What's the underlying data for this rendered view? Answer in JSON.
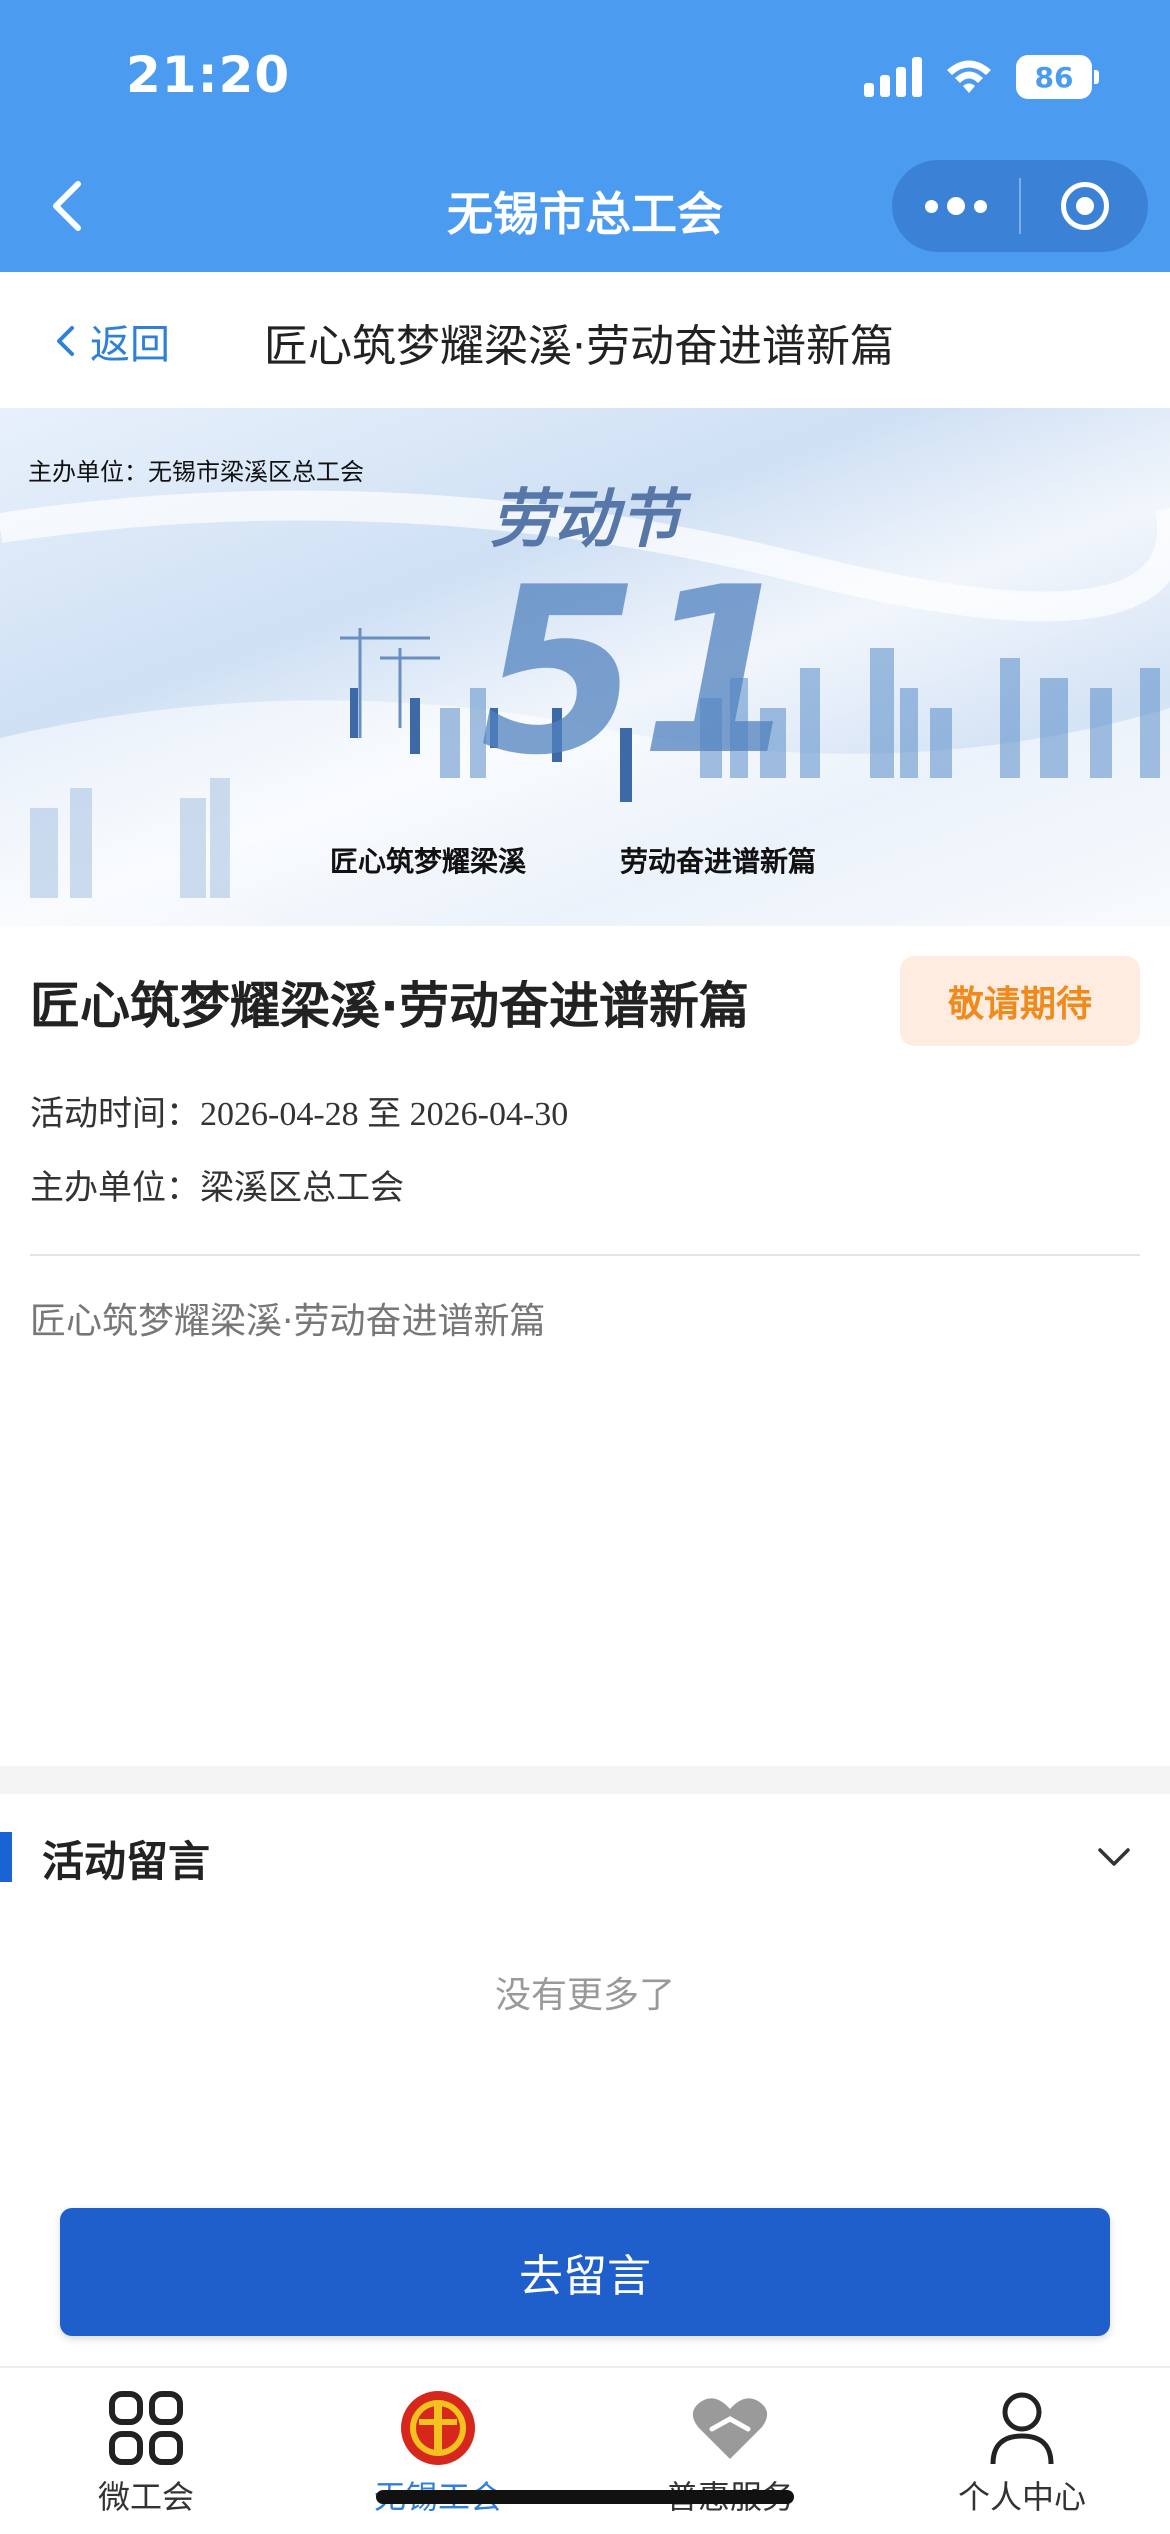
{
  "status_bar": {
    "time": "21:20",
    "battery": "86"
  },
  "nav": {
    "title": "无锡市总工会"
  },
  "subheader": {
    "back_label": "返回",
    "title": "匠心筑梦耀梁溪·劳动奋进谱新篇"
  },
  "banner": {
    "organizer": "主办单位：无锡市梁溪区总工会",
    "festival_text": "劳动节",
    "number": "51",
    "slogan_left": "匠心筑梦耀梁溪",
    "slogan_right": "劳动奋进谱新篇"
  },
  "activity": {
    "title": "匠心筑梦耀梁溪·劳动奋进谱新篇",
    "status": "敬请期待",
    "time_label": "活动时间：",
    "time_value": "2026-04-28 至 2026-04-30",
    "organizer_label": "主办单位：",
    "organizer_value": "梁溪区总工会",
    "description": "匠心筑梦耀梁溪·劳动奋进谱新篇"
  },
  "comments": {
    "title": "活动留言",
    "empty_text": "没有更多了",
    "button_label": "去留言"
  },
  "tabbar": {
    "items": [
      {
        "label": "微工会",
        "icon": "grid-icon"
      },
      {
        "label": "无锡工会",
        "icon": "union-emblem-icon"
      },
      {
        "label": "普惠服务",
        "icon": "heart-hands-icon"
      },
      {
        "label": "个人中心",
        "icon": "person-icon"
      }
    ],
    "active_index": 1
  },
  "colors": {
    "nav_blue": "#4b9bf0",
    "button_blue": "#1e5fcc",
    "badge_orange": "#f08a1c",
    "link_blue": "#2f80d9"
  }
}
